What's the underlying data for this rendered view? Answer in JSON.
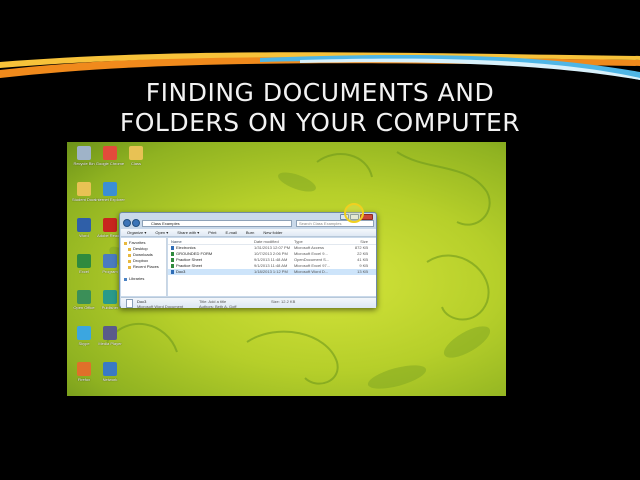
{
  "slide": {
    "title_line1": "FINDING DOCUMENTS AND",
    "title_line2": "FOLDERS ON YOUR COMPUTER"
  },
  "colors": {
    "background": "#000000",
    "title": "#f2f2f2",
    "wallpaper": "#b6cf2a",
    "accent_orange": "#f08a1c",
    "accent_blue": "#4fb6e6"
  },
  "desktop_icons": [
    {
      "label": "Recycle Bin",
      "icon": "recycle-bin-icon",
      "color": "#9fb3c8"
    },
    {
      "label": "Google Chrome",
      "icon": "chrome-icon",
      "color": "#e24b3b"
    },
    {
      "label": "Class",
      "icon": "folder-icon",
      "color": "#e8c254"
    },
    {
      "label": "Student Docs",
      "icon": "folder-icon",
      "color": "#e8c254"
    },
    {
      "label": "Internet Explorer",
      "icon": "ie-icon",
      "color": "#3b8fd4"
    },
    {
      "label": "Word",
      "icon": "word-icon",
      "color": "#2f5fa8"
    },
    {
      "label": "Adobe Reader",
      "icon": "pdf-icon",
      "color": "#c8251e"
    },
    {
      "label": "Excel",
      "icon": "excel-icon",
      "color": "#2f8a3e"
    },
    {
      "label": "Program",
      "icon": "app-icon",
      "color": "#4b7bbf"
    },
    {
      "label": "Open Office",
      "icon": "app-icon",
      "color": "#3b8f58"
    },
    {
      "label": "Publisher",
      "icon": "app-icon",
      "color": "#2a9a8a"
    },
    {
      "label": "Skype",
      "icon": "app-icon",
      "color": "#3ba6e0"
    },
    {
      "label": "Media Player",
      "icon": "app-icon",
      "color": "#5a5a8a"
    },
    {
      "label": "Firefox",
      "icon": "firefox-icon",
      "color": "#e0702a"
    },
    {
      "label": "Network",
      "icon": "app-icon",
      "color": "#3a7ac4"
    }
  ],
  "explorer": {
    "address": "Class Examples",
    "search_placeholder": "Search Class Examples",
    "toolbar": [
      "Organize ▾",
      "Open ▾",
      "Share with ▾",
      "Print",
      "E-mail",
      "Burn",
      "New folder"
    ],
    "nav": [
      {
        "label": "Favorites",
        "indent": false,
        "kind": "star"
      },
      {
        "label": "Desktop",
        "indent": true,
        "kind": "folder"
      },
      {
        "label": "Downloads",
        "indent": true,
        "kind": "folder"
      },
      {
        "label": "Dropbox",
        "indent": true,
        "kind": "folder"
      },
      {
        "label": "Recent Places",
        "indent": true,
        "kind": "folder"
      },
      {
        "label": "",
        "indent": false,
        "kind": "spacer"
      },
      {
        "label": "Libraries",
        "indent": false,
        "kind": "library"
      }
    ],
    "columns": {
      "name": "Name",
      "date": "Date modified",
      "type": "Type",
      "size": "Size"
    },
    "files": [
      {
        "name": "Electronics",
        "date": "1/31/2013 12:07 PM",
        "type": "Microsoft Access",
        "size": "872 KB",
        "icon": "access",
        "selected": false
      },
      {
        "name": "GROUNDED FORM",
        "date": "10/7/2013 2:06 PM",
        "type": "Microsoft Excel 9...",
        "size": "22 KB",
        "icon": "xls",
        "selected": false
      },
      {
        "name": "Practice Sheet",
        "date": "9/1/2013 11:48 AM",
        "type": "OpenDocument S...",
        "size": "41 KB",
        "icon": "xls",
        "selected": false
      },
      {
        "name": "Practice Sheet",
        "date": "9/1/2013 11:48 AM",
        "type": "Microsoft Excel 97...",
        "size": "9 KB",
        "icon": "xls",
        "selected": false
      },
      {
        "name": "Doc3",
        "date": "1/18/2013 1:12 PM",
        "type": "Microsoft Word D...",
        "size": "13 KB",
        "icon": "doc",
        "selected": true
      }
    ],
    "details": {
      "name": "Doc3",
      "type": "Microsoft Word Document",
      "title": "Title:  Add a title",
      "authors": "Authors:  Beth A. Goff",
      "size": "Size:  12.2 KB"
    }
  }
}
